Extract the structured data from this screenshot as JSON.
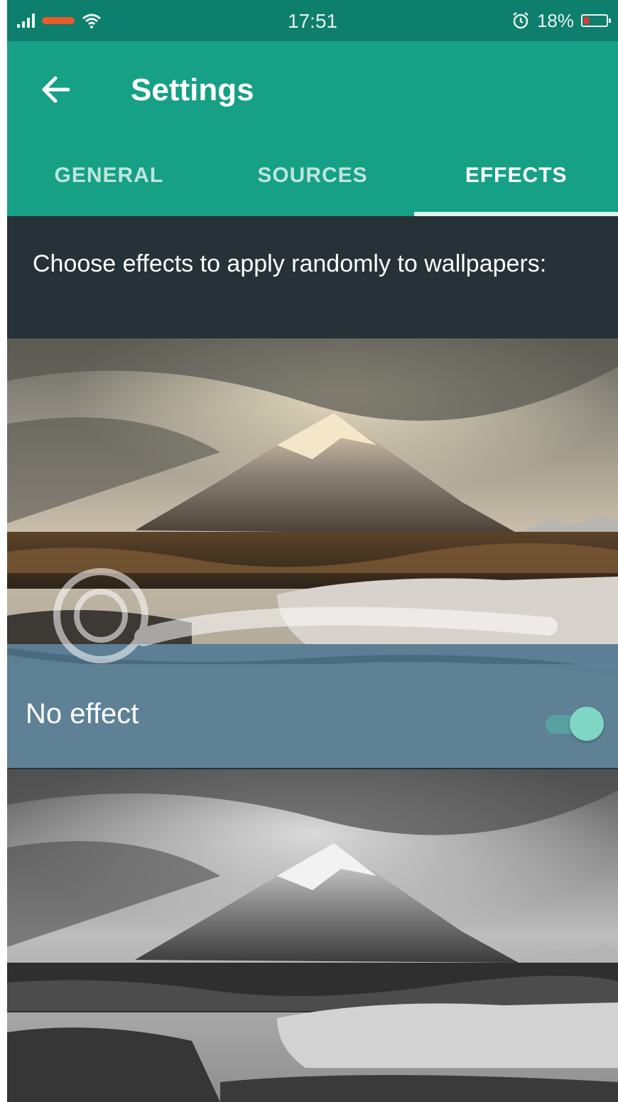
{
  "status_bar": {
    "time": "17:51",
    "battery": "18%",
    "icons": [
      "signal-icon",
      "carrier-icon",
      "wifi-icon",
      "alarm-icon",
      "battery-icon"
    ]
  },
  "app_bar": {
    "title": "Settings",
    "back_icon": "back-arrow-icon",
    "color": "#16a085"
  },
  "tabs": [
    {
      "label": "GENERAL",
      "active": false
    },
    {
      "label": "SOURCES",
      "active": false
    },
    {
      "label": "EFFECTS",
      "active": true
    }
  ],
  "intro_text": "Choose effects to apply randomly to wallpapers:",
  "effects": [
    {
      "label": "No effect",
      "enabled": true,
      "style": "color"
    },
    {
      "label": "",
      "style": "grayscale"
    }
  ],
  "colors": {
    "status_bar": "#0e7f6c",
    "background": "#263238",
    "switch_on": "#7fd6c4"
  }
}
